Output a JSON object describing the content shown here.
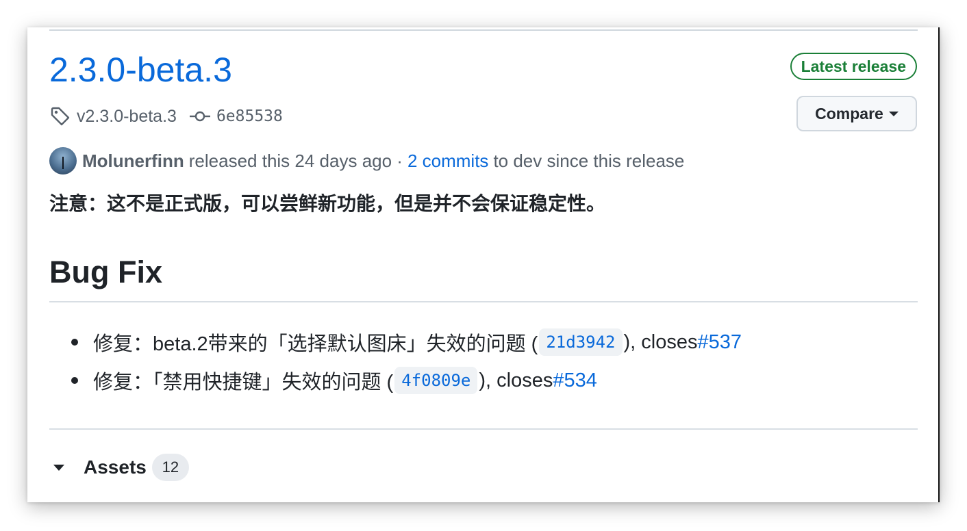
{
  "release": {
    "title": "2.3.0-beta.3",
    "latest_badge": "Latest release",
    "compare_label": "Compare",
    "tag": "v2.3.0-beta.3",
    "commit": "6e85538",
    "author": "Molunerfinn",
    "released_text": "released this 24 days ago ·",
    "commits_link": "2 commits",
    "commits_suffix": "to dev since this release"
  },
  "body": {
    "note": "注意：这不是正式版，可以尝鲜新功能，但是并不会保证稳定性。",
    "section_title": "Bug Fix",
    "items": [
      {
        "prefix": "修复：beta.2带来的「选择默认图床」失效的问题 (",
        "commit": "21d3942",
        "middle": "), closes ",
        "issue": "#537"
      },
      {
        "prefix": "修复：「禁用快捷键」失效的问题 (",
        "commit": "4f0809e",
        "middle": "), closes ",
        "issue": "#534"
      }
    ]
  },
  "assets": {
    "label": "Assets",
    "count": "12"
  },
  "colors": {
    "link": "#0969da",
    "success": "#1a7f37",
    "text": "#1f2328",
    "muted": "#57606a",
    "border": "#d0d7de"
  },
  "icons": [
    "tag-icon",
    "git-commit-icon",
    "dropdown-caret-icon",
    "disclosure-triangle-icon"
  ]
}
